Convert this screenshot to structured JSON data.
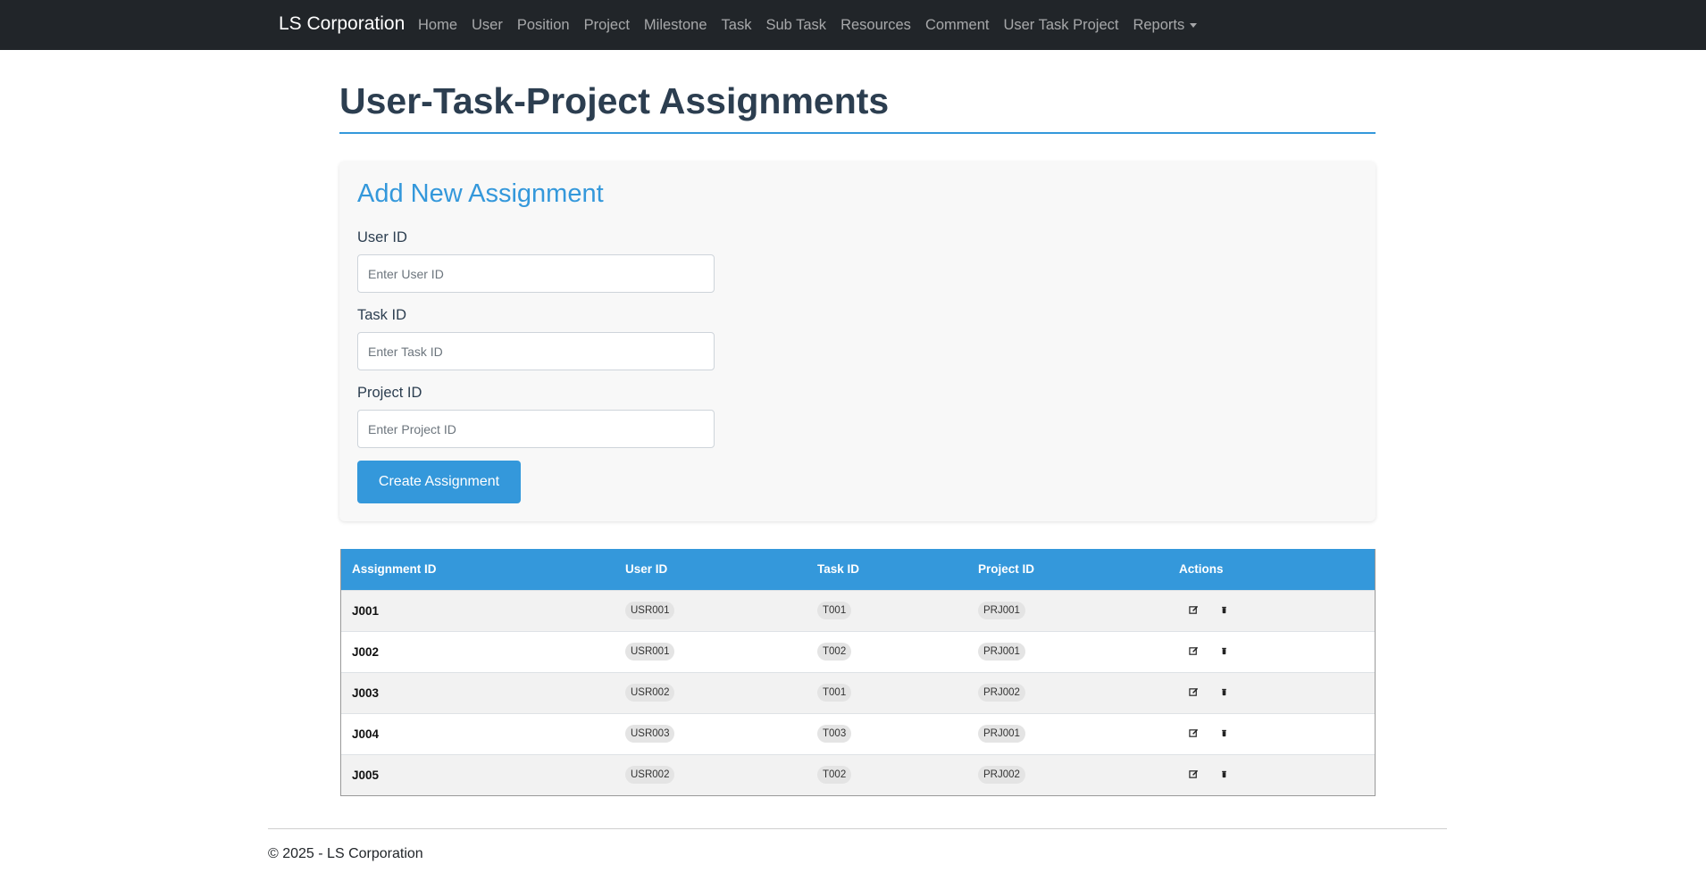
{
  "navbar": {
    "brand": "LS Corporation",
    "links": [
      "Home",
      "User",
      "Position",
      "Project",
      "Milestone",
      "Task",
      "Sub Task",
      "Resources",
      "Comment",
      "User Task Project"
    ],
    "reports": "Reports"
  },
  "page": {
    "title": "User-Task-Project Assignments"
  },
  "form": {
    "heading": "Add New Assignment",
    "user_label": "User ID",
    "user_placeholder": "Enter User ID",
    "task_label": "Task ID",
    "task_placeholder": "Enter Task ID",
    "project_label": "Project ID",
    "project_placeholder": "Enter Project ID",
    "submit_label": "Create Assignment"
  },
  "table": {
    "headers": [
      "Assignment ID",
      "User ID",
      "Task ID",
      "Project ID",
      "Actions"
    ],
    "rows": [
      {
        "id": "J001",
        "user": "USR001",
        "task": "T001",
        "project": "PRJ001"
      },
      {
        "id": "J002",
        "user": "USR001",
        "task": "T002",
        "project": "PRJ001"
      },
      {
        "id": "J003",
        "user": "USR002",
        "task": "T001",
        "project": "PRJ002"
      },
      {
        "id": "J004",
        "user": "USR003",
        "task": "T003",
        "project": "PRJ001"
      },
      {
        "id": "J005",
        "user": "USR002",
        "task": "T002",
        "project": "PRJ002"
      }
    ],
    "row_actions": [
      "edit-icon",
      "delete-icon"
    ]
  },
  "footer": {
    "text": "© 2025 - LS Corporation"
  },
  "colors": {
    "navbar_bg": "#212529",
    "accent": "#3498db",
    "title": "#2c3e50"
  }
}
